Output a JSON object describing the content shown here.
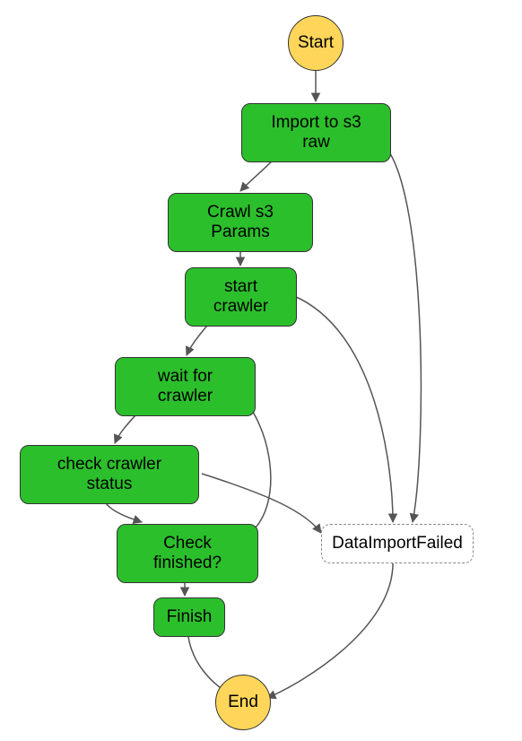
{
  "chart_data": {
    "type": "flowchart",
    "nodes": [
      {
        "id": "start",
        "label": "Start",
        "kind": "terminator"
      },
      {
        "id": "import",
        "label": "Import to s3 raw",
        "kind": "process"
      },
      {
        "id": "params",
        "label": "Crawl s3 Params",
        "kind": "process"
      },
      {
        "id": "startcrawler",
        "label": "start crawler",
        "kind": "process"
      },
      {
        "id": "wait",
        "label": "wait for crawler",
        "kind": "process"
      },
      {
        "id": "checkstatus",
        "label": "check crawler status",
        "kind": "process"
      },
      {
        "id": "checkfinished",
        "label": "Check finished?",
        "kind": "decision"
      },
      {
        "id": "finish",
        "label": "Finish",
        "kind": "process"
      },
      {
        "id": "failed",
        "label": "DataImportFailed",
        "kind": "error"
      },
      {
        "id": "end",
        "label": "End",
        "kind": "terminator"
      }
    ],
    "edges": [
      {
        "from": "start",
        "to": "import"
      },
      {
        "from": "import",
        "to": "params"
      },
      {
        "from": "import",
        "to": "failed"
      },
      {
        "from": "params",
        "to": "startcrawler"
      },
      {
        "from": "startcrawler",
        "to": "wait"
      },
      {
        "from": "startcrawler",
        "to": "failed"
      },
      {
        "from": "wait",
        "to": "checkstatus"
      },
      {
        "from": "checkstatus",
        "to": "checkfinished"
      },
      {
        "from": "checkstatus",
        "to": "failed"
      },
      {
        "from": "checkfinished",
        "to": "finish"
      },
      {
        "from": "checkfinished",
        "to": "wait",
        "note": "loop back"
      },
      {
        "from": "finish",
        "to": "end"
      },
      {
        "from": "failed",
        "to": "end"
      }
    ]
  },
  "labels": {
    "start": "Start",
    "import": "Import to s3 raw",
    "params": "Crawl s3 Params",
    "startcrawler": "start crawler",
    "wait": "wait for crawler",
    "checkstatus": "check crawler status",
    "checkfinished": "Check finished?",
    "finish": "Finish",
    "failed": "DataImportFailed",
    "end": "End"
  }
}
